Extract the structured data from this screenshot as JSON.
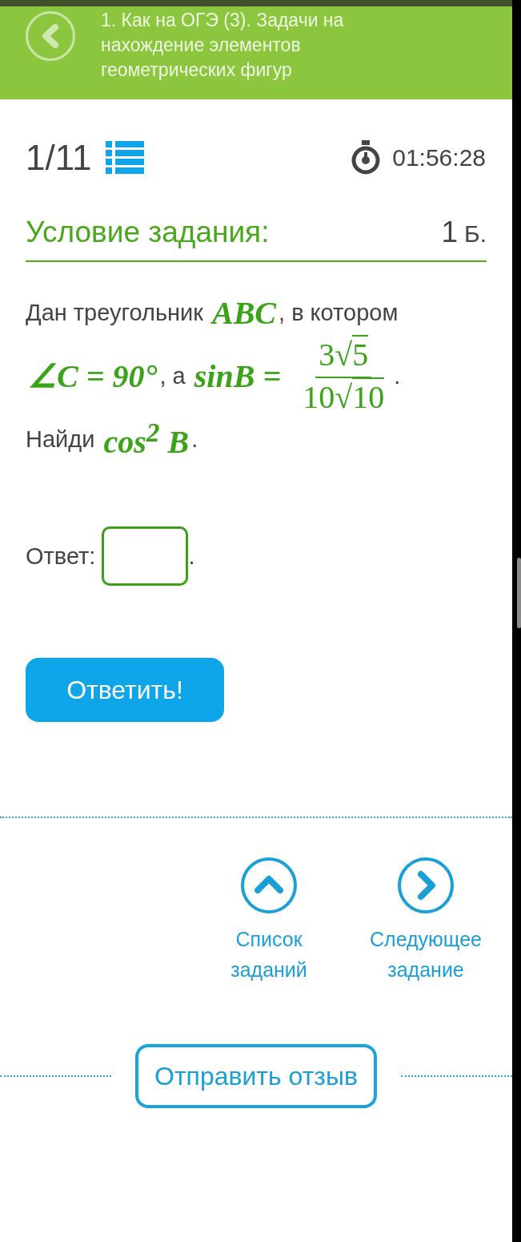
{
  "header": {
    "title": "1. Как на ОГЭ (3). Задачи на нахождение элементов геометрических фигур"
  },
  "progress": {
    "counter": "1/11",
    "timer": "01:56:28"
  },
  "task": {
    "heading": "Условие задания:",
    "points": "1",
    "points_unit": "Б.",
    "lines": [
      [
        {
          "kind": "text",
          "text": "Дан треугольник "
        },
        {
          "kind": "math",
          "text": "ABC"
        },
        {
          "kind": "text",
          "text": ", в котором"
        }
      ],
      [
        {
          "kind": "math",
          "text": "∠C = 90°"
        },
        {
          "kind": "text",
          "text": ", а "
        },
        {
          "kind": "math",
          "text": "sinB ="
        },
        {
          "kind": "fraction",
          "num_coef": "3",
          "num_radical": "√",
          "num_radicand": "5",
          "den_coef": "10",
          "den_radical": "√",
          "den_radicand": "10"
        },
        {
          "kind": "text",
          "text": "."
        }
      ],
      [
        {
          "kind": "text",
          "text": "Найди "
        },
        {
          "kind": "math",
          "text": "cos$^{2}$ B"
        },
        {
          "kind": "text",
          "text": "."
        }
      ]
    ],
    "answer_label": "Ответ:",
    "answer_suffix": ".",
    "submit": "Ответить!"
  },
  "nav": [
    {
      "kind": "up",
      "label": "Список заданий"
    },
    {
      "kind": "next",
      "label": "Следующее задание"
    }
  ],
  "feedback": "Отправить отзыв"
}
